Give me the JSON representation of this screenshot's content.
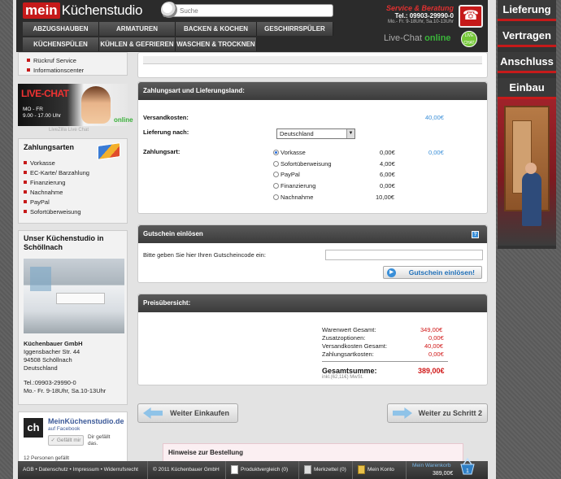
{
  "header": {
    "logo_mein": "mein",
    "logo_rest": "Küchenstudio",
    "search_placeholder": "Suche",
    "service_title": "Service & Beratung",
    "service_phone": "Tel.: 09903-29990-0",
    "service_hours": "Mo.- Fr. 9-18Uhr, Sa.10-13Uhr",
    "livechat_label": "Live-Chat",
    "livechat_status": "online",
    "livechat_badge": "LIVE CHAT"
  },
  "nav": {
    "row1": [
      "ABZUGSHAUBEN",
      "ARMATUREN",
      "BACKEN & KOCHEN",
      "GESCHIRRSPÜLER"
    ],
    "row2": [
      "KÜCHENSPÜLEN",
      "KÜHLEN & GEFRIEREN",
      "WASCHEN & TROCKNEN"
    ]
  },
  "right_promo": [
    "Lieferung",
    "Vertragen",
    "Anschluss",
    "Einbau"
  ],
  "sidebar": {
    "service_links": [
      "Rückruf Service",
      "Informationscenter"
    ],
    "chat_ad": {
      "title": "LIVE-CHAT",
      "days": "MO - FR",
      "hours": "9.00 - 17.00 Uhr",
      "status": "online",
      "caption": "LiveZilla Live Chat"
    },
    "payment": {
      "title": "Zahlungsarten",
      "items": [
        "Vorkasse",
        "EC-Karte/ Barzahlung",
        "Finanzierung",
        "Nachnahme",
        "PayPal",
        "Sofortüberweisung"
      ]
    },
    "store": {
      "title": "Unser Küchenstudio in Schöllnach",
      "company": "Küchenbauer GmbH",
      "street": "Iggensbacher Str. 44",
      "city": "94508 Schöllnach",
      "country": "Deutschland",
      "tel": "Tel.:09903-29990-0",
      "hours": "Mo.- Fr. 9-18Uhr, Sa.10-13Uhr"
    },
    "facebook": {
      "logo": "ch",
      "name": "MeinKüchenstudio.de",
      "sub": "auf Facebook",
      "like": "Gefällt mir",
      "liked": "Dir gefällt das.",
      "count": "12 Personen gefällt"
    }
  },
  "payment_panel": {
    "title": "Zahlungsart und Lieferungsland:",
    "shipping_label": "Versandkosten:",
    "shipping_value": "40,00€",
    "delivery_label": "Lieferung nach:",
    "delivery_value": "Deutschland",
    "method_label": "Zahlungsart:",
    "methods": [
      {
        "name": "Vorkasse",
        "fee": "0,00€",
        "extra": "0,00€",
        "selected": true
      },
      {
        "name": "Sofortüberweisung",
        "fee": "4,00€",
        "extra": "",
        "selected": false
      },
      {
        "name": "PayPal",
        "fee": "6,00€",
        "extra": "",
        "selected": false
      },
      {
        "name": "Finanzierung",
        "fee": "0,00€",
        "extra": "",
        "selected": false
      },
      {
        "name": "Nachnahme",
        "fee": "10,00€",
        "extra": "",
        "selected": false
      }
    ]
  },
  "coupon_panel": {
    "title": "Gutschein einlösen",
    "help": "?",
    "prompt": "Bitte geben Sie hier Ihren Gutscheincode ein:",
    "button": "Gutschein einlösen!"
  },
  "price_panel": {
    "title": "Preisübersicht:",
    "rows": [
      {
        "label": "Warenwert Gesamt:",
        "value": "349,00€"
      },
      {
        "label": "Zusatzoptionen:",
        "value": "0,00€"
      },
      {
        "label": "Versandkosten Gesamt:",
        "value": "40,00€"
      },
      {
        "label": "Zahlungsartkosten:",
        "value": "0,00€"
      }
    ],
    "total_label": "Gesamtsumme:",
    "total_value": "389,00€",
    "vat": "inkl.(62,11€) MwSt."
  },
  "actions": {
    "back": "Weiter Einkaufen",
    "next": "Weiter zu Schritt 2"
  },
  "notice_title": "Hinweise zur Bestellung",
  "footer": {
    "legal": "AGB • Datenschutz • Impressum • Widerrufsrecht",
    "copyright": "© 2011 Küchenbauer GmbH",
    "compare": "Produktvergleich (0)",
    "memo": "Merkzettel (0)",
    "account": "Mein Konto",
    "basket_label": "Mein Warenkorb",
    "basket_total": "389,00€",
    "basket_count": "1"
  },
  "colors": {
    "brand_red": "#c61a1a",
    "link_blue": "#3a8fd8",
    "price_red": "#d01818",
    "online_green": "#3ab53a"
  }
}
